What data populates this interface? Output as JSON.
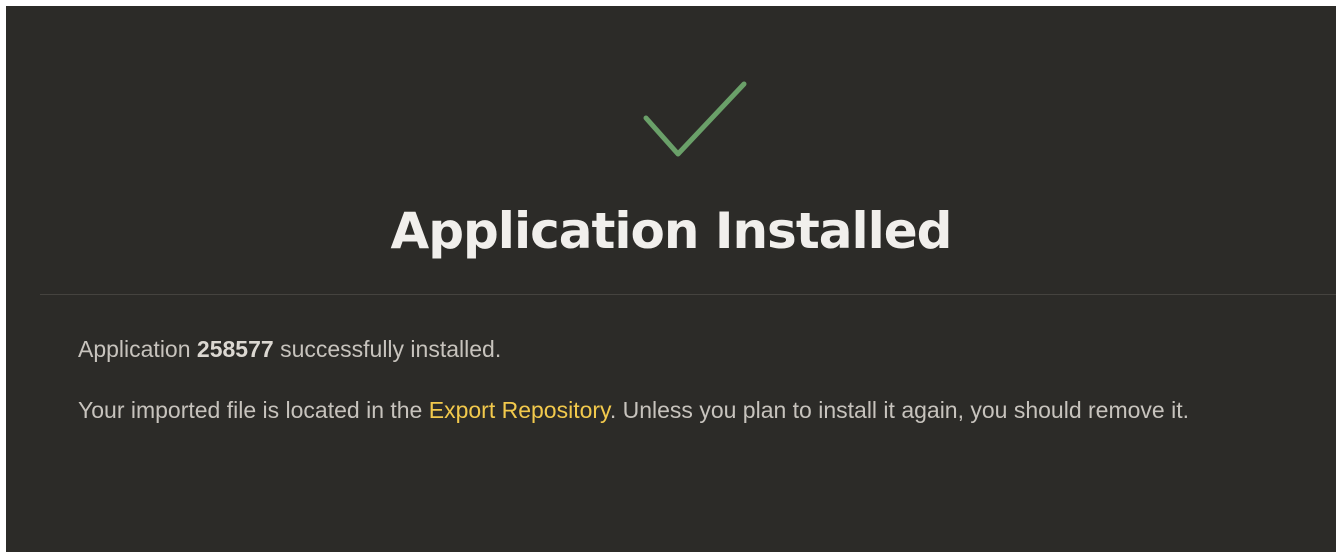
{
  "header": {
    "icon": "check-icon",
    "title": "Application Installed"
  },
  "message": {
    "prefix": "Application",
    "app_id": "258577",
    "suffix": "successfully installed."
  },
  "note": {
    "before_link": "Your imported file is located in the",
    "link_label": "Export Repository",
    "after_link": ". Unless you plan to install it again, you should remove it."
  },
  "colors": {
    "background": "#2c2b28",
    "check": "#6aa069",
    "title": "#f1efec",
    "text": "#c7c3bd",
    "link": "#f2c94c"
  }
}
